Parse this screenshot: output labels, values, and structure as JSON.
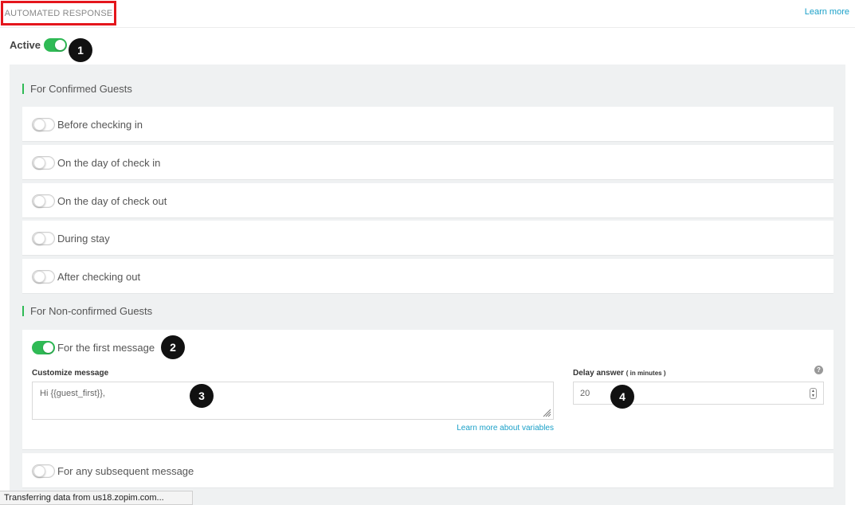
{
  "header": {
    "title": "AUTOMATED RESPONSE",
    "learn_more": "Learn more"
  },
  "active": {
    "label": "Active",
    "enabled": true,
    "badge": "1"
  },
  "confirmed": {
    "section_label": "For Confirmed Guests",
    "items": [
      {
        "label": "Before checking in",
        "enabled": false
      },
      {
        "label": "On the day of check in",
        "enabled": false
      },
      {
        "label": "On the day of check out",
        "enabled": false
      },
      {
        "label": "During stay",
        "enabled": false
      },
      {
        "label": "After checking out",
        "enabled": false
      }
    ]
  },
  "non_confirmed": {
    "section_label": "For Non-confirmed Guests",
    "first_message": {
      "label": "For the first message",
      "enabled": true,
      "badge": "2",
      "customize_label": "Customize message",
      "message_value": "Hi {{guest_first}},",
      "message_badge": "3",
      "delay_label": "Delay answer",
      "delay_unit": "( in minutes )",
      "delay_value": "20",
      "delay_badge": "4",
      "help_icon": "?",
      "vars_link": "Learn more about variables"
    },
    "subsequent": {
      "label": "For any subsequent message",
      "enabled": false
    }
  },
  "status_bar": "Transferring data from us18.zopim.com...",
  "colors": {
    "accent_green": "#2fba55",
    "link_blue": "#1aa0c8",
    "highlight_red": "#e4161c",
    "panel_bg": "#eff1f2"
  }
}
